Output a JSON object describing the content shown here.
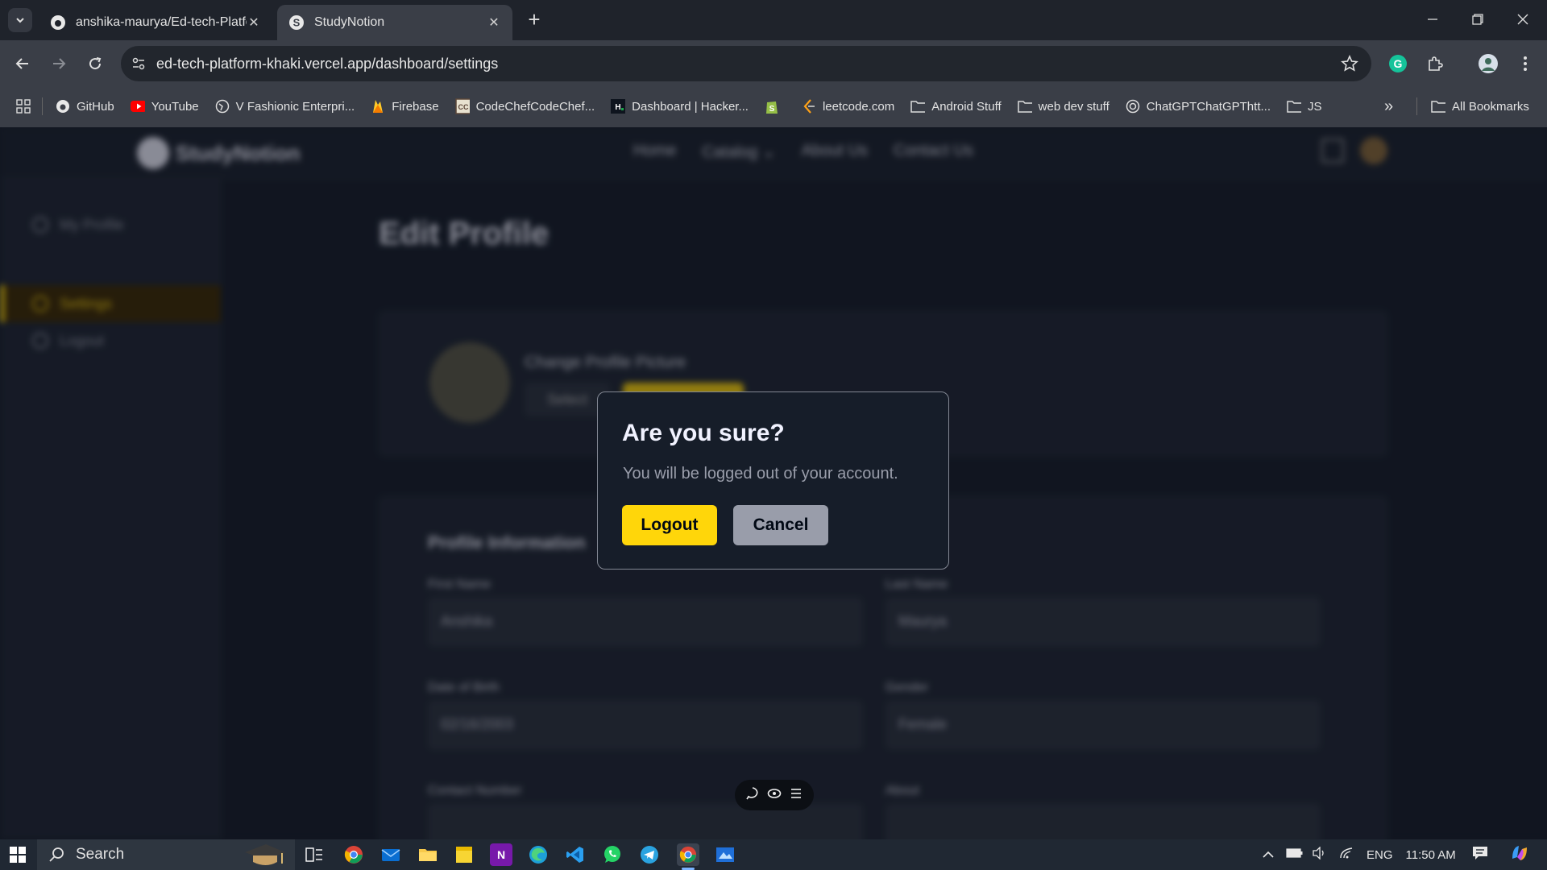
{
  "browser": {
    "tabs": [
      {
        "title": "anshika-maurya/Ed-tech-Platfo",
        "favicon": "github-icon",
        "active": false
      },
      {
        "title": "StudyNotion",
        "favicon": "studynotion-icon",
        "active": true
      }
    ],
    "url": "ed-tech-platform-khaki.vercel.app/dashboard/settings",
    "bookmarks": [
      {
        "label": "GitHub",
        "icon": "github-icon"
      },
      {
        "label": "YouTube",
        "icon": "youtube-icon"
      },
      {
        "label": "V Fashionic Enterpri...",
        "icon": "globe-icon"
      },
      {
        "label": "Firebase",
        "icon": "firebase-icon"
      },
      {
        "label": "CodeChefCodeChef...",
        "icon": "codechef-icon"
      },
      {
        "label": "Dashboard | Hacker...",
        "icon": "hackerrank-icon"
      },
      {
        "label": "",
        "icon": "shopify-icon"
      },
      {
        "label": "leetcode.com",
        "icon": "leetcode-icon"
      },
      {
        "label": "Android Stuff",
        "icon": "folder-icon"
      },
      {
        "label": "web dev stuff",
        "icon": "folder-icon"
      },
      {
        "label": "ChatGPTChatGPThtt...",
        "icon": "openai-icon"
      },
      {
        "label": "JS",
        "icon": "folder-icon"
      }
    ],
    "all_bookmarks": "All Bookmarks"
  },
  "site": {
    "brand": "StudyNotion",
    "nav": [
      "Home",
      "Catalog",
      "About Us",
      "Contact Us"
    ],
    "sidebar": [
      {
        "label": "My Profile",
        "active": false
      },
      {
        "label": "Settings",
        "active": true
      },
      {
        "label": "Logout",
        "active": false
      }
    ],
    "page_title": "Edit Profile",
    "profile_picture": {
      "heading": "Change Profile Picture",
      "select_label": "Select"
    },
    "profile_info": {
      "heading": "Profile Information",
      "first_name_label": "First Name",
      "first_name_value": "Anshika",
      "last_name_label": "Last Name",
      "last_name_value": "Maurya",
      "dob_label": "Date of Birth",
      "dob_value": "02/16/2003",
      "gender_label": "Gender",
      "gender_value": "Female",
      "contact_label": "Contact Number",
      "about_label": "About"
    }
  },
  "modal": {
    "title": "Are you sure?",
    "text": "You will be logged out of your account.",
    "confirm_label": "Logout",
    "cancel_label": "Cancel"
  },
  "taskbar": {
    "search_placeholder": "Search",
    "language": "ENG",
    "time": "11:50 AM"
  },
  "colors": {
    "accent_yellow": "#ffd60a",
    "modal_bg": "#161d29",
    "cancel_gray": "#999daa"
  }
}
